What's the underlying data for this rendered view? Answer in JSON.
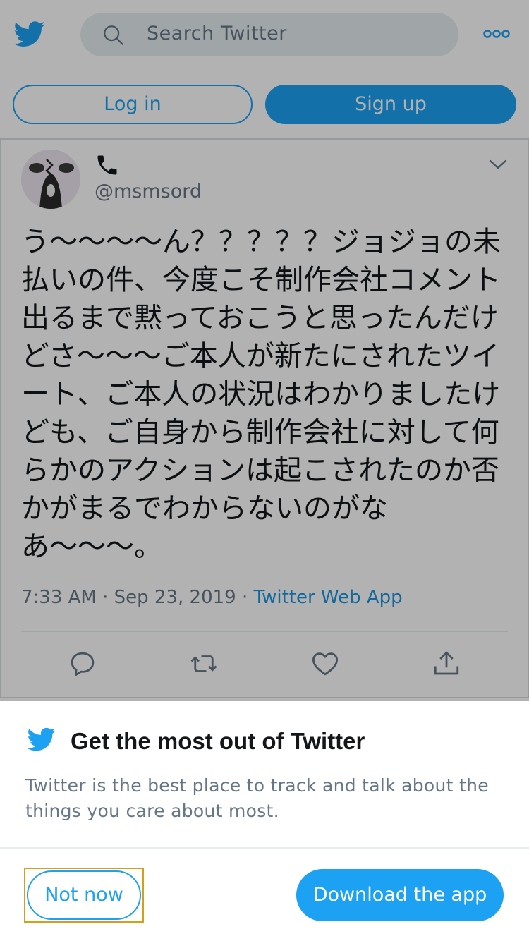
{
  "header": {
    "search_placeholder": "Search Twitter",
    "login_label": "Log in",
    "signup_label": "Sign up"
  },
  "tweet": {
    "handle": "@msmsord",
    "text": "う〜〜〜〜ん？？？？？ジョジョの未払いの件、今度こそ制作会社コメント出るまで黙っておこうと思ったんだけどさ〜〜〜ご本人が新たにされたツイート、ご本人の状況はわかりましたけども、ご自身から制作会社に対して何らかのアクションは起こされたのか否かがまるでわからないのがなあ〜〜〜。",
    "time": "7:33 AM",
    "date": "Sep 23, 2019",
    "dot": "·",
    "source": "Twitter Web App"
  },
  "sheet": {
    "title": "Get the most out of Twitter",
    "body": "Twitter is the best place to track and talk about the things you care about most.",
    "not_now_label": "Not now",
    "download_label": "Download the app"
  },
  "colors": {
    "brand": "#1da1f2",
    "secondary_text": "#657786",
    "primary_text": "#14171a"
  },
  "icons": [
    "twitter-bird-icon",
    "search-icon",
    "more-icon",
    "phone-icon",
    "chevron-down-icon",
    "reply-icon",
    "retweet-icon",
    "like-icon",
    "share-icon"
  ]
}
